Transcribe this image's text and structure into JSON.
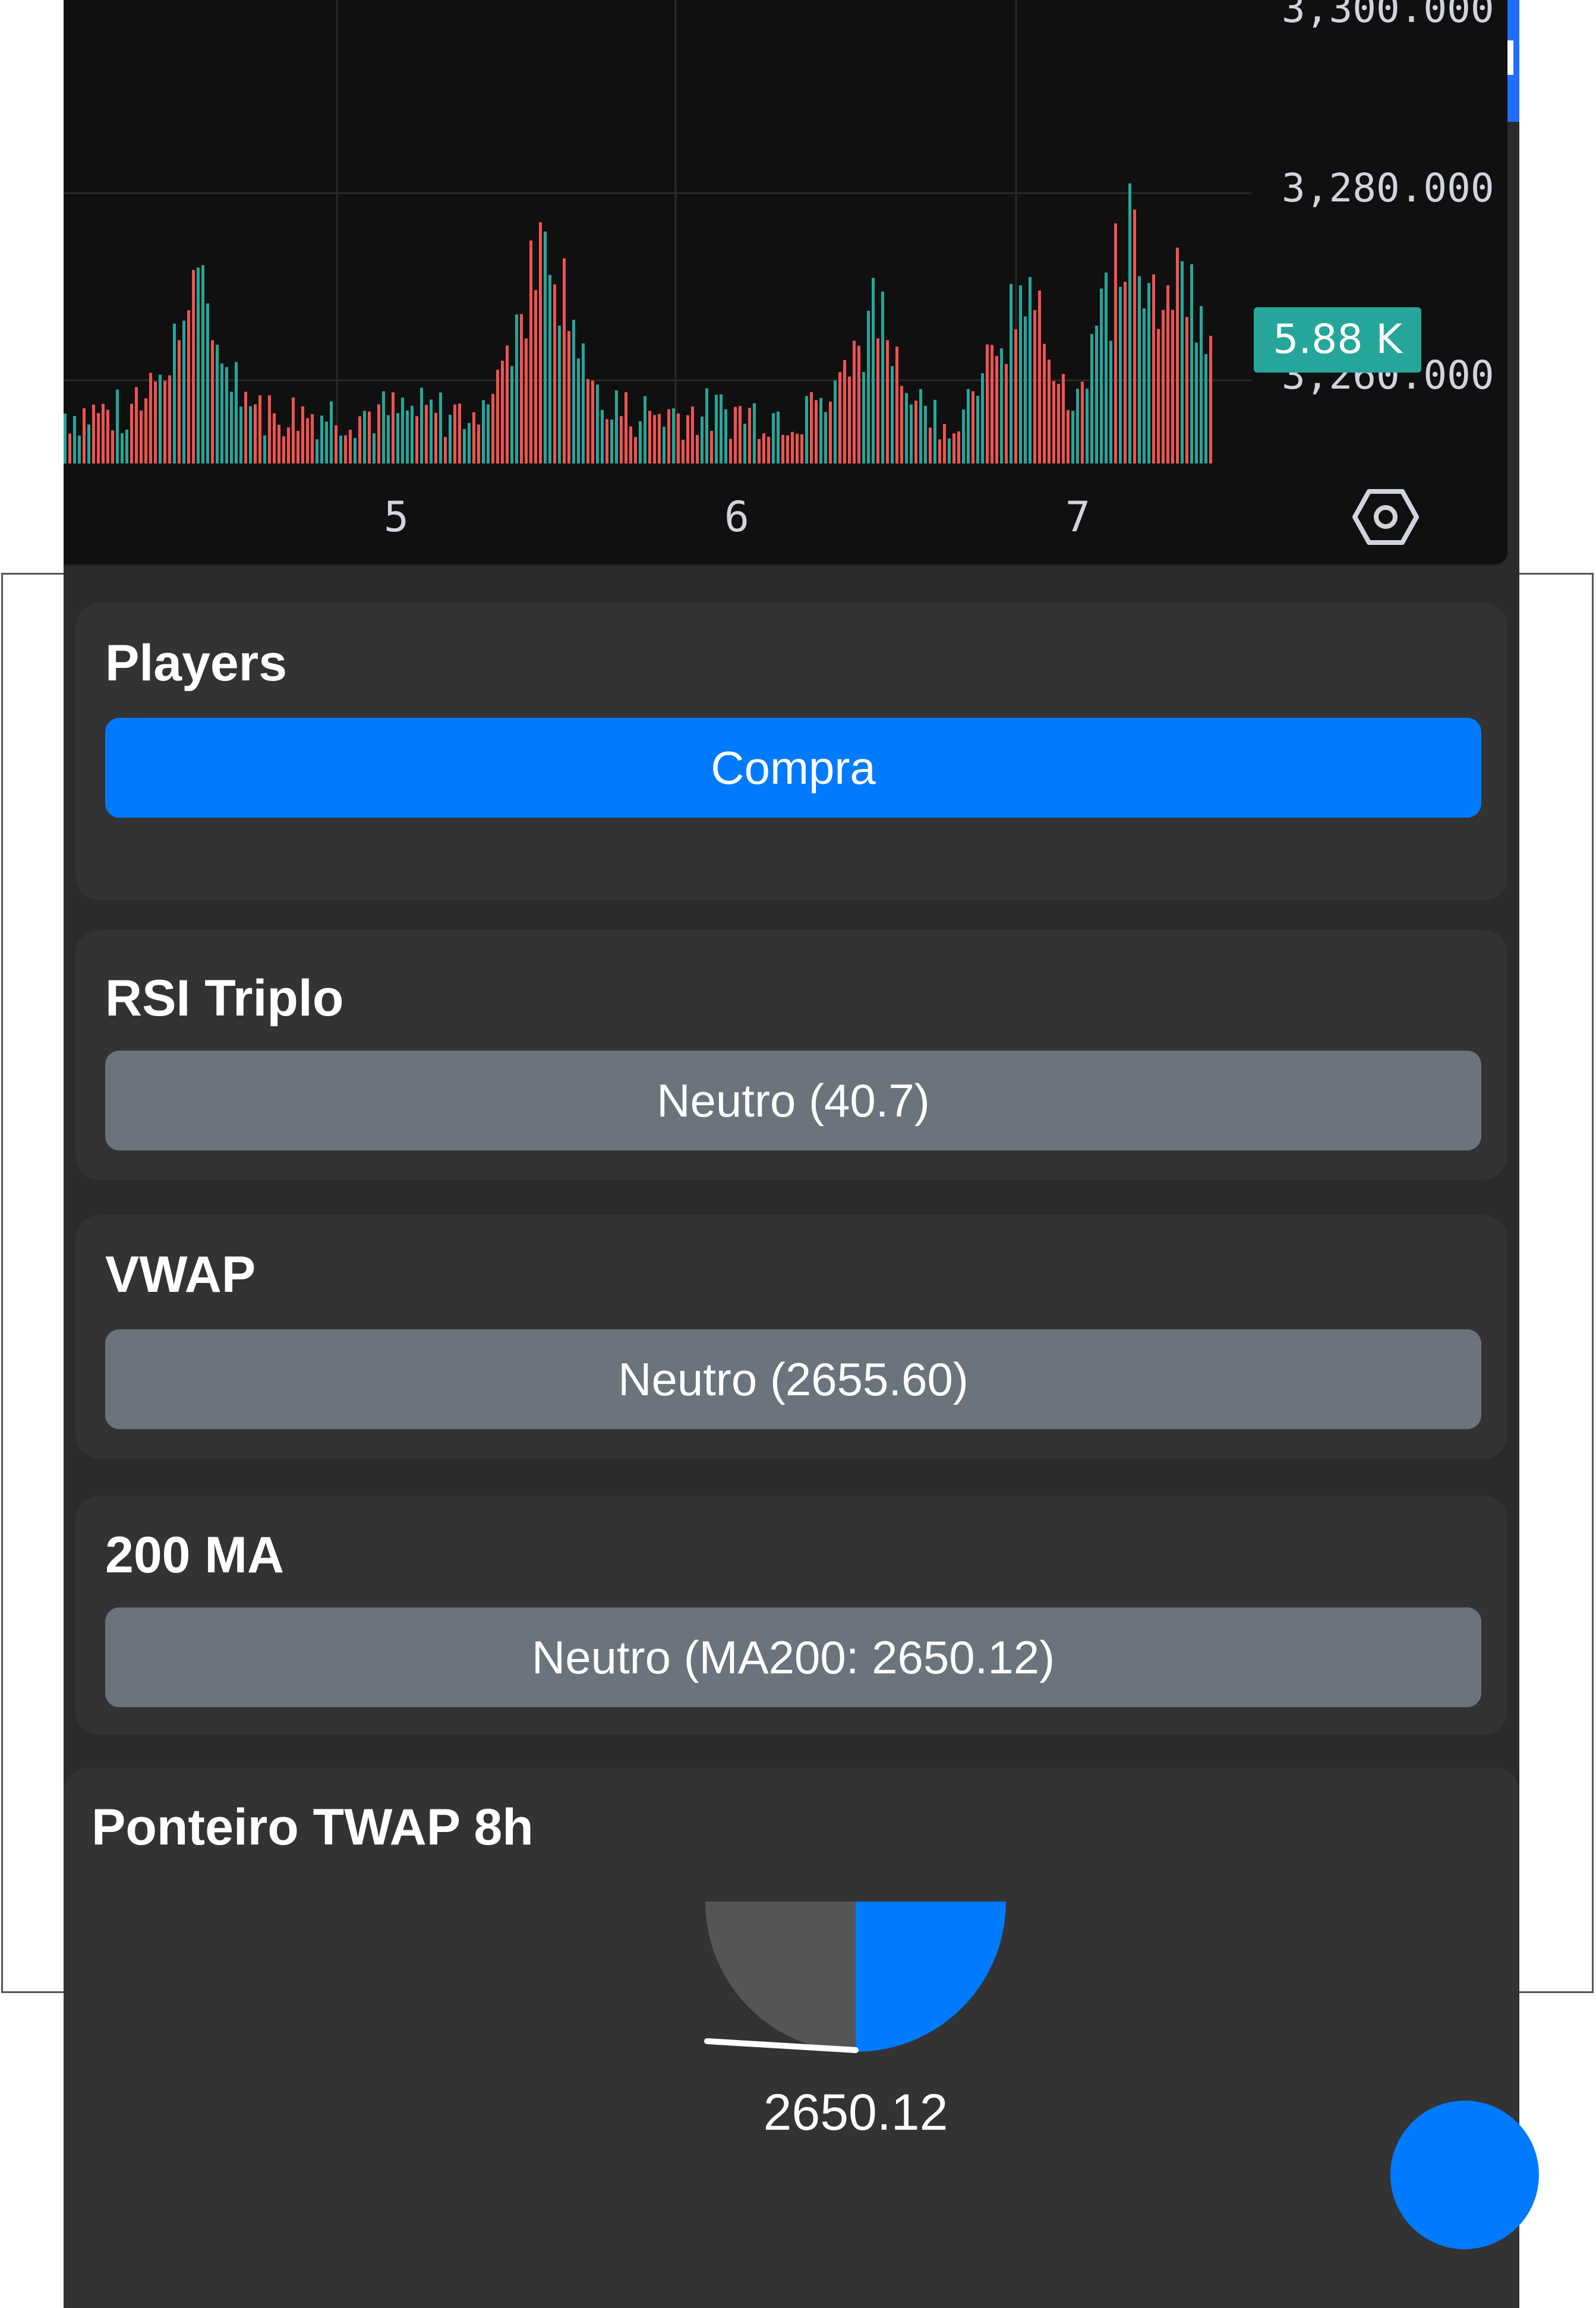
{
  "chart": {
    "y_ticks": [
      "3,300.000",
      "3,280.000",
      "3,260.000"
    ],
    "x_ticks": [
      "5",
      "6",
      "7"
    ],
    "price_badge": "5.88 K",
    "bull_color": "#26a69a",
    "bear_color": "#ef5350",
    "settings_icon": "settings-hexagon-icon"
  },
  "players": {
    "title": "Players",
    "signal": "Compra",
    "signal_color": "#007bff"
  },
  "rsi": {
    "title": "RSI Triplo",
    "signal": "Neutro (40.7)"
  },
  "vwap": {
    "title": "VWAP",
    "signal": "Neutro (2655.60)"
  },
  "ma200": {
    "title": "200 MA",
    "signal": "Neutro (MA200: 2650.12)"
  },
  "twap": {
    "title": "Ponteiro TWAP 8h",
    "value": "2650.12",
    "gauge_fill_fraction": 0.5,
    "gauge_color": "#007bff"
  },
  "colors": {
    "neutral": "#6b737c",
    "card_bg": "#333333",
    "chart_bg": "#101010"
  }
}
